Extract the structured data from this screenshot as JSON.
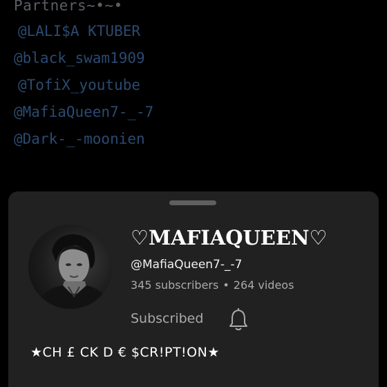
{
  "background": {
    "partners_title": "Partners~•~•",
    "partner_handles": [
      "@LALI$A KTUBER",
      "@black_swam1909",
      "@TofiX_youtube",
      "@MafiaQueen7-_-7",
      "@Dark-_-moonien"
    ]
  },
  "channel_sheet": {
    "name": "♡MAFIAQUEEN♡",
    "handle": "@MafiaQueen7-_-7",
    "subscribers": "345 subscribers",
    "separator": "•",
    "videos": "264 videos",
    "subscribe_button_label": "Subscribed",
    "bell_icon": "bell-icon",
    "description": "★CH £ CK D € $CR!PT!ON★"
  },
  "colors": {
    "page_background": "#000000",
    "sheet_background": "#212121",
    "partner_link": "#2b4a70",
    "muted_text": "#aaaaaa"
  }
}
